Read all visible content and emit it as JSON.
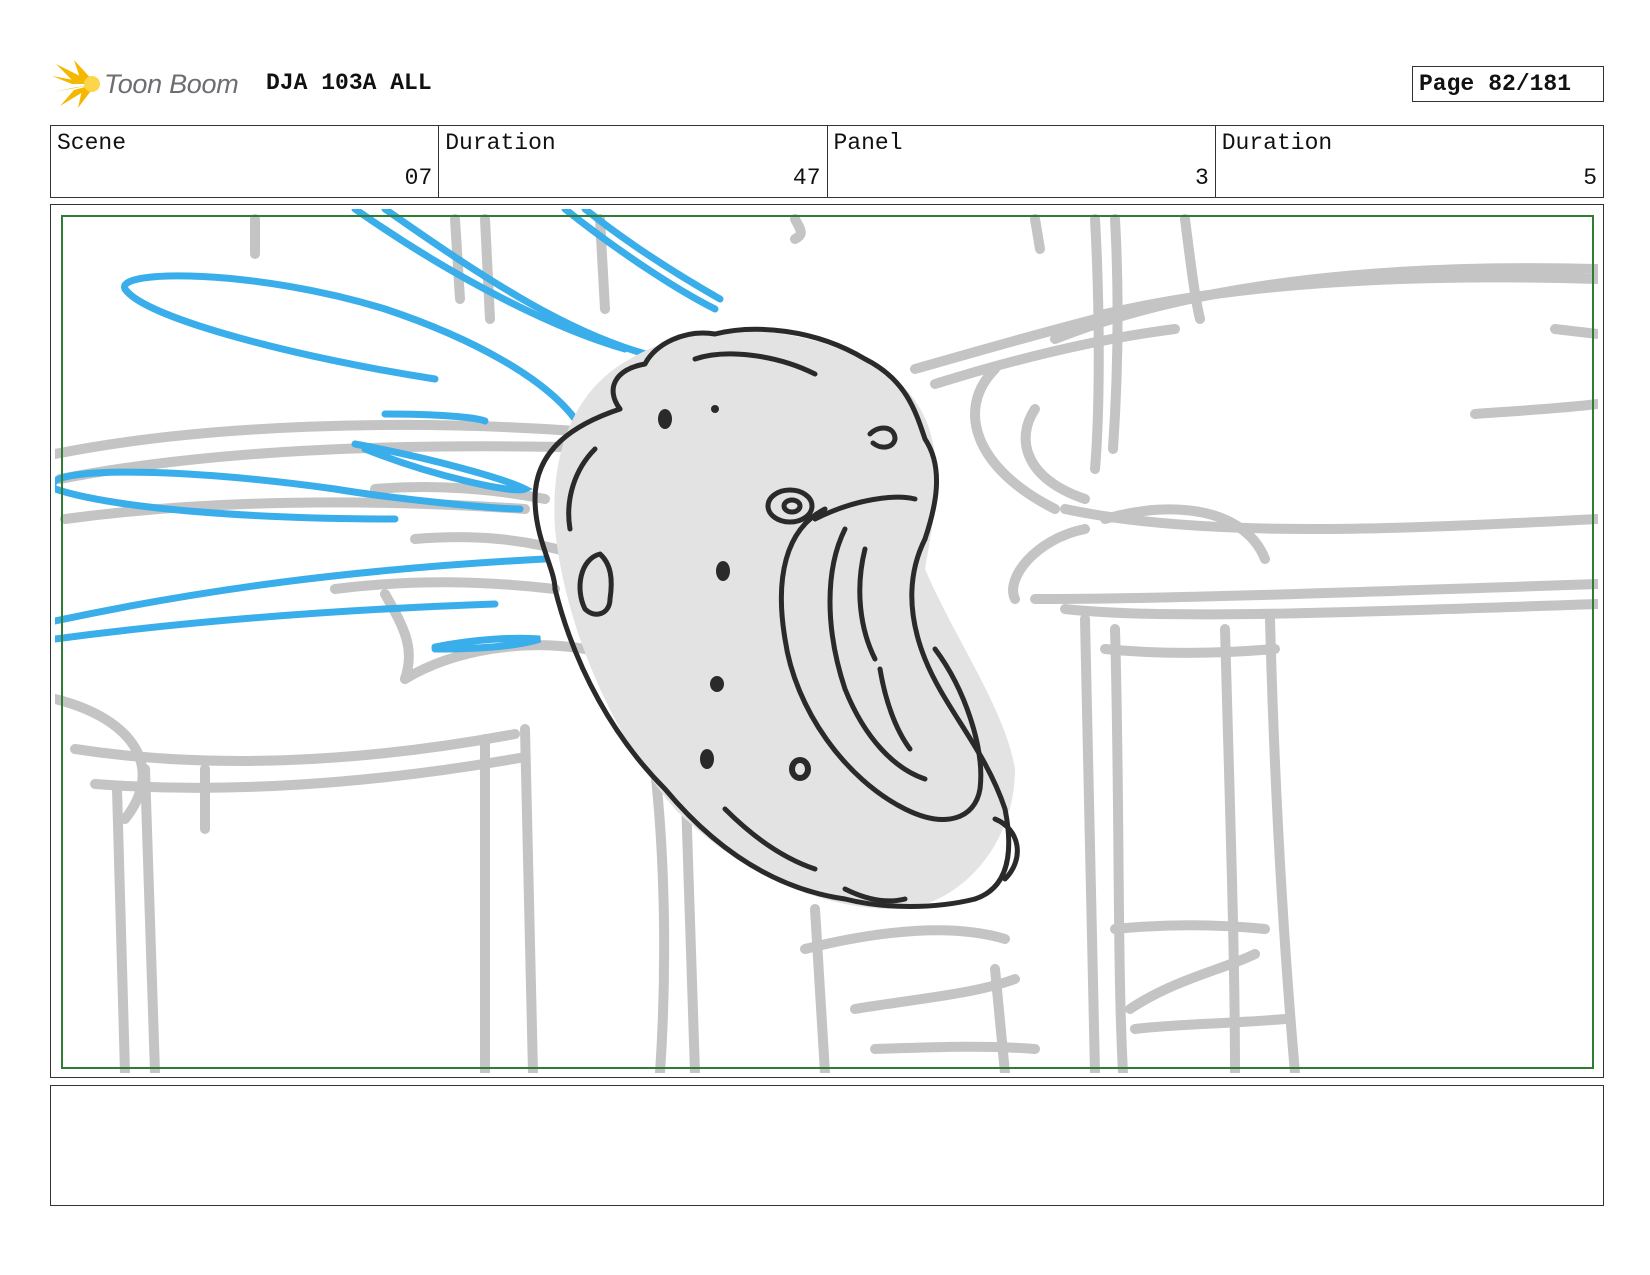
{
  "header": {
    "logo_text": "Toon Boom",
    "project_title": "DJA 103A ALL"
  },
  "page": {
    "label": "Page",
    "number": "82/181"
  },
  "info": {
    "scene_label": "Scene",
    "scene_value": "07",
    "scene_duration_label": "Duration",
    "scene_duration_value": "47",
    "panel_label": "Panel",
    "panel_value": "3",
    "panel_duration_label": "Duration",
    "panel_duration_value": "5"
  },
  "notes": {
    "text": ""
  },
  "colors": {
    "frame_border": "#2e7d32",
    "background_sketch": "#c4c4c4",
    "motion_lines": "#3aaeea",
    "character_ink": "#2a2a2a",
    "character_fill": "#e3e3e3",
    "logo_yellow": "#f5b800"
  }
}
